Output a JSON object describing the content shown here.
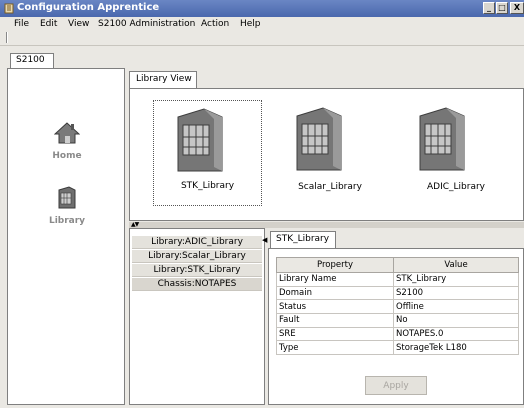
{
  "window": {
    "title": "Configuration Apprentice",
    "buttons": {
      "minimize": "_",
      "maximize": "□",
      "close": "X"
    }
  },
  "menubar": {
    "items": [
      "File",
      "Edit",
      "View",
      "S2100 Administration",
      "Action",
      "Help"
    ]
  },
  "left_panel": {
    "tab": "S2100",
    "items": [
      {
        "label": "Home",
        "icon": "home-icon"
      },
      {
        "label": "Library",
        "icon": "library-icon"
      }
    ]
  },
  "library_view": {
    "tab": "Library View",
    "libraries": [
      {
        "label": "STK_Library",
        "selected": true
      },
      {
        "label": "Scalar_Library",
        "selected": false
      },
      {
        "label": "ADIC_Library",
        "selected": false
      }
    ]
  },
  "tree_list": {
    "items": [
      "Library:ADIC_Library",
      "Library:Scalar_Library",
      "Library:STK_Library",
      "Chassis:NOTAPES"
    ]
  },
  "details": {
    "tab": "STK_Library",
    "headers": {
      "property": "Property",
      "value": "Value"
    },
    "rows": [
      {
        "property": "Library Name",
        "value": "STK_Library"
      },
      {
        "property": "Domain",
        "value": "S2100"
      },
      {
        "property": "Status",
        "value": "Offline"
      },
      {
        "property": "Fault",
        "value": "No"
      },
      {
        "property": "SRE",
        "value": "NOTAPES.0"
      },
      {
        "property": "Type",
        "value": "StorageTek L180"
      }
    ],
    "apply_label": "Apply"
  }
}
